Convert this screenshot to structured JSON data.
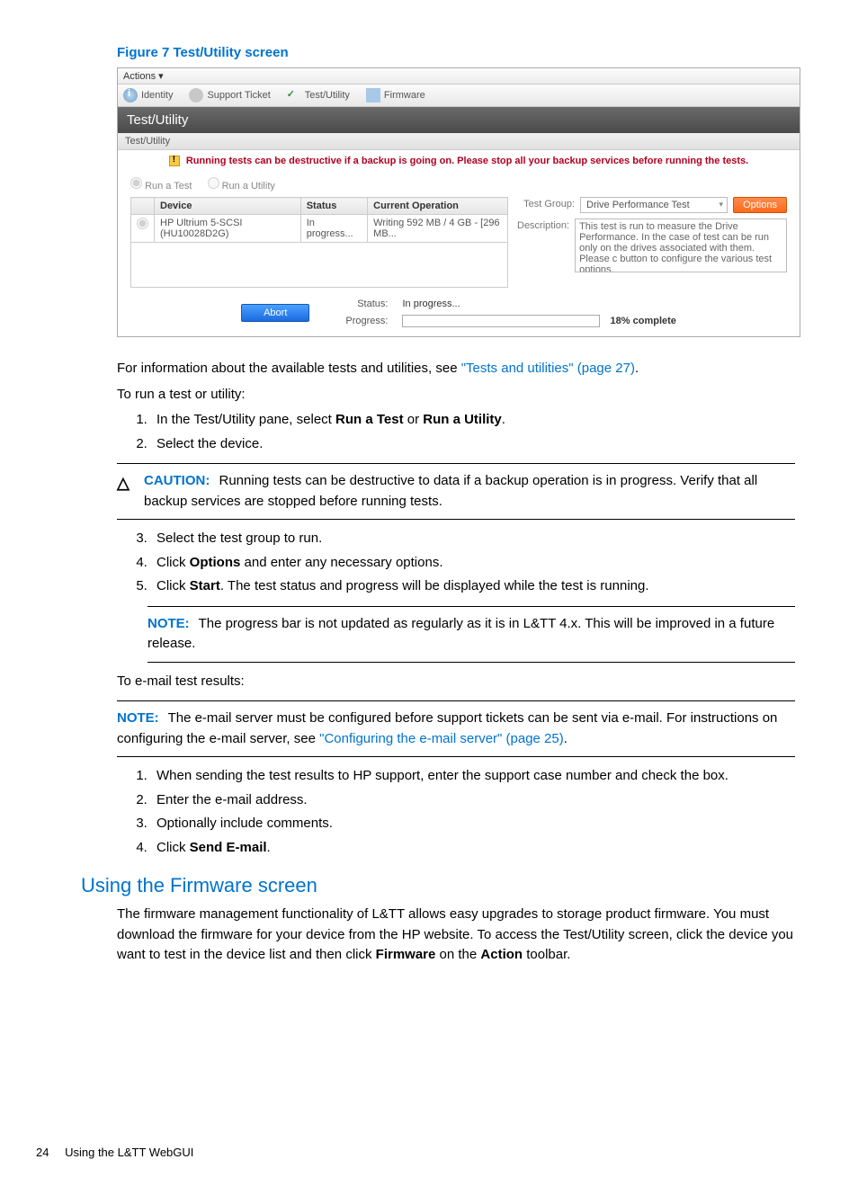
{
  "figure_title": "Figure 7 Test/Utility screen",
  "screenshot": {
    "actions_label": "Actions ▾",
    "tabs": {
      "identity": "Identity",
      "support": "Support Ticket",
      "testutil": "Test/Utility",
      "firmware": "Firmware"
    },
    "section_title": "Test/Utility",
    "subsection_title": "Test/Utility",
    "warning": "Running tests can be destructive if a backup is going on. Please stop all your backup services before running the tests.",
    "radio": {
      "run_test": "Run a Test",
      "run_utility": "Run a Utility"
    },
    "table": {
      "headers": {
        "device": "Device",
        "status": "Status",
        "operation": "Current Operation"
      },
      "row": {
        "device": "HP Ultrium 5-SCSI (HU10028D2G)",
        "status": "In progress...",
        "operation": "Writing 592 MB / 4 GB - [296 MB..."
      }
    },
    "right": {
      "test_group_label": "Test Group:",
      "test_group_value": "Drive Performance Test",
      "options_btn": "Options",
      "description_label": "Description:",
      "description_value": "This test is run to measure the Drive Performance. In the case of test can be run only on the drives associated with them. Please c button to configure the various test options."
    },
    "status": {
      "abort_btn": "Abort",
      "status_label": "Status:",
      "status_value": "In progress...",
      "progress_label": "Progress:",
      "progress_value": "18% complete"
    }
  },
  "body": {
    "para_info_pre": "For information about the available tests and utilities, see ",
    "para_info_link": "\"Tests and utilities\" (page 27)",
    "para_info_post": ".",
    "para_run": "To run a test or utility:",
    "step1_pre": "In the Test/Utility pane, select ",
    "step1_b1": "Run a Test",
    "step1_mid": " or ",
    "step1_b2": "Run a Utility",
    "step1_post": ".",
    "step2": "Select the device.",
    "caution_label": "CAUTION:",
    "caution_text": "Running tests can be destructive to data if a backup operation is in progress. Verify that all backup services are stopped before running tests.",
    "step3": "Select the test group to run.",
    "step4_pre": "Click ",
    "step4_b": "Options",
    "step4_post": " and enter any necessary options.",
    "step5_pre": "Click ",
    "step5_b": "Start",
    "step5_post": ". The test status and progress will be displayed while the test is running.",
    "note1_label": "NOTE:",
    "note1_text": "The progress bar is not updated as regularly as it is in L&TT 4.x. This will be improved in a future release.",
    "para_email": "To e-mail test results:",
    "note2_label": "NOTE:",
    "note2_text_pre": "The e-mail server must be configured before support tickets can be sent via e-mail. For instructions on configuring the e-mail server, see ",
    "note2_link": "\"Configuring the e-mail server\" (page 25)",
    "note2_post": ".",
    "estep1": "When sending the test results to HP support, enter the support case number and check the box.",
    "estep2": "Enter the e-mail address.",
    "estep3": "Optionally include comments.",
    "estep4_pre": "Click ",
    "estep4_b": "Send E-mail",
    "estep4_post": ".",
    "fw_heading": "Using the Firmware screen",
    "fw_para_pre": "The firmware management functionality of L&TT allows easy upgrades to storage product firmware. You must download the firmware for your device from the HP website. To access the Test/Utility screen, click the device you want to test in the device list and then click ",
    "fw_b1": "Firmware",
    "fw_mid": " on the ",
    "fw_b2": "Action",
    "fw_post": " toolbar."
  },
  "footer": {
    "page": "24",
    "title": "Using the L&TT WebGUI"
  }
}
